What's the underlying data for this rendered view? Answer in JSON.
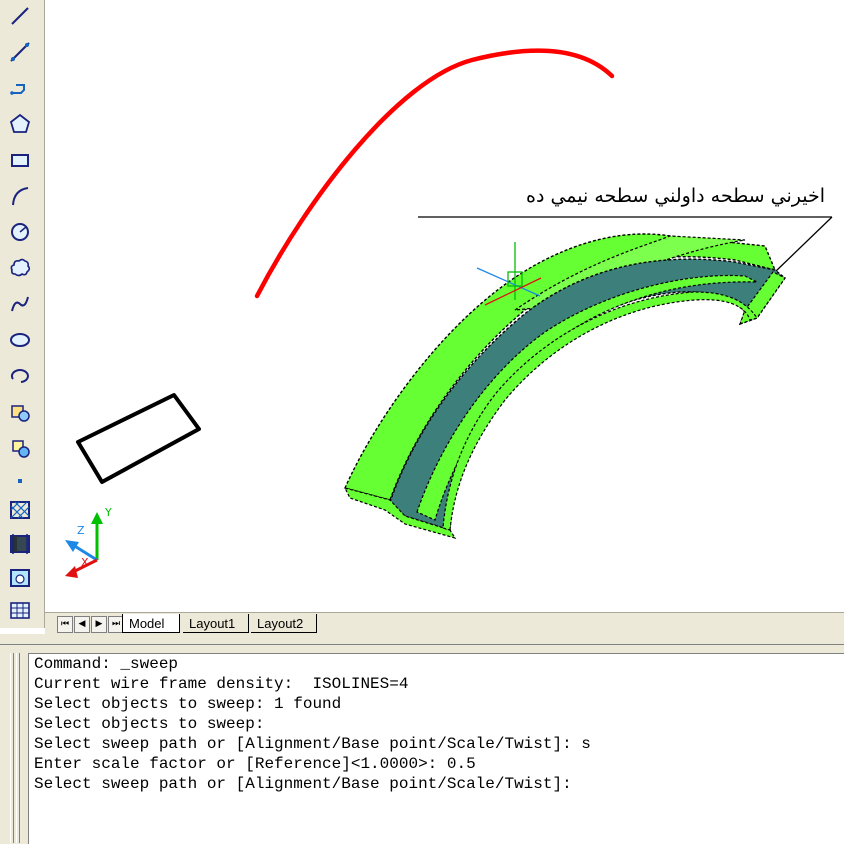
{
  "toolbar": {
    "tools": [
      {
        "icon": "line-icon"
      },
      {
        "icon": "construction-line-icon"
      },
      {
        "icon": "polyline-icon"
      },
      {
        "icon": "polygon-icon"
      },
      {
        "icon": "rectangle-icon"
      },
      {
        "icon": "arc-icon"
      },
      {
        "icon": "circle-icon"
      },
      {
        "icon": "revision-cloud-icon"
      },
      {
        "icon": "spline-icon"
      },
      {
        "icon": "ellipse-icon"
      },
      {
        "icon": "ellipse-arc-icon"
      },
      {
        "icon": "insert-block-icon"
      },
      {
        "icon": "make-block-icon"
      },
      {
        "icon": "point-icon"
      },
      {
        "icon": "hatch-icon"
      },
      {
        "icon": "gradient-icon"
      },
      {
        "icon": "region-icon"
      },
      {
        "icon": "table-icon"
      }
    ]
  },
  "drawing": {
    "annotation": "اخيرني سطحه داولني سطحه نيمي ده",
    "ucs_labels": {
      "x": "X",
      "y": "Y",
      "z": "Z"
    },
    "colors": {
      "path": "#ff0000",
      "solid_light": "#66ff33",
      "solid_face": "#3d7f7a",
      "profile": "#000000",
      "selection_dash": "#000000",
      "ucs_x": "#e01010",
      "ucs_y": "#00c000",
      "ucs_z": "#1e88e5"
    }
  },
  "tabs": {
    "nav": {
      "first": "⏮",
      "prev": "◀",
      "next": "▶",
      "last": "⏭"
    },
    "model": "Model",
    "layout1": "Layout1",
    "layout2": "Layout2"
  },
  "command": {
    "lines": [
      "Command: _sweep",
      "Current wire frame density:  ISOLINES=4",
      "Select objects to sweep: 1 found",
      "Select objects to sweep:",
      "Select sweep path or [Alignment/Base point/Scale/Twist]: s",
      "Enter scale factor or [Reference]<1.0000>: 0.5",
      "Select sweep path or [Alignment/Base point/Scale/Twist]:"
    ]
  }
}
